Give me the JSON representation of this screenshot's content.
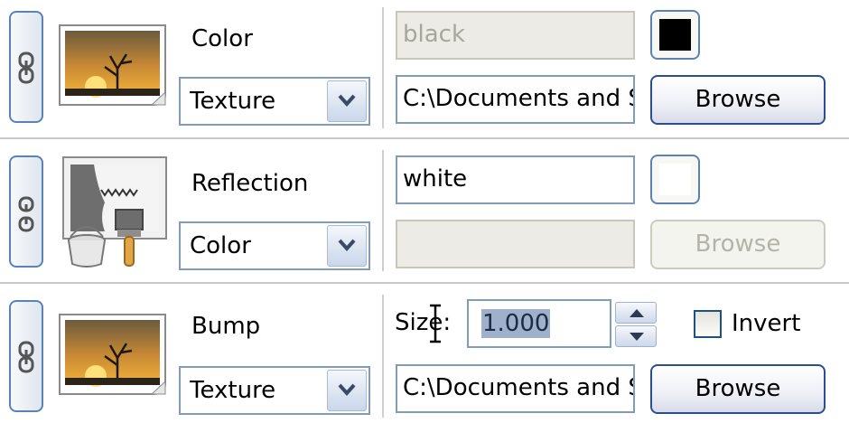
{
  "channels": [
    {
      "label": "Color",
      "source_mode": "Texture",
      "color_value": "black",
      "color_swatch": "#000000",
      "color_field_enabled": false,
      "texture_path": "C:\\Documents and Settings",
      "browse_label": "Browse",
      "browse_enabled": true,
      "thumbnail_icon": "sunset-tree-texture-icon"
    },
    {
      "label": "Reflection",
      "source_mode": "Color",
      "color_value": "white",
      "color_swatch": "#ffffff",
      "color_field_enabled": true,
      "texture_path": "",
      "browse_label": "Browse",
      "browse_enabled": false,
      "thumbnail_icon": "paint-bucket-brush-icon"
    },
    {
      "label": "Bump",
      "source_mode": "Texture",
      "size_label": "Size:",
      "size_value": "1.000",
      "invert_label": "Invert",
      "invert_checked": false,
      "texture_path": "C:\\Documents and Settings",
      "browse_label": "Browse",
      "browse_enabled": true,
      "thumbnail_icon": "sunset-tree-texture-icon"
    }
  ],
  "colors": {
    "accent_border": "#7f9db9",
    "button_border": "#294f90",
    "separator": "#c8c8c8"
  }
}
